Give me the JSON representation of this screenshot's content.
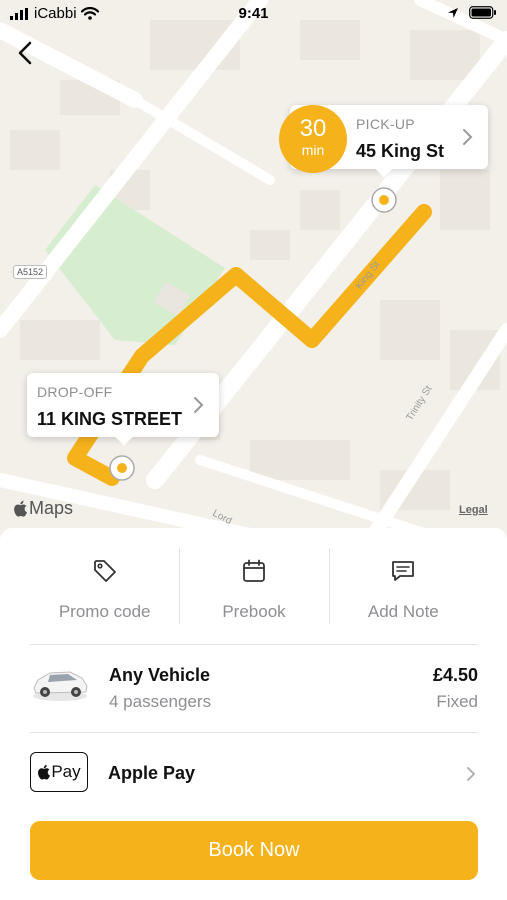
{
  "status_bar": {
    "carrier": "iCabbi",
    "time": "9:41",
    "icons": [
      "signal-icon",
      "wifi-icon",
      "location-arrow-icon",
      "battery-icon"
    ]
  },
  "map": {
    "road_badge": "A5152",
    "street_labels": [
      "King St",
      "Trinity St",
      "Lord"
    ],
    "maps_logo": "Maps",
    "legal": "Legal",
    "route_color": "#F5B21B"
  },
  "pickup": {
    "eta_value": "30",
    "eta_unit": "min",
    "label": "PICK-UP",
    "address": "45 King St"
  },
  "dropoff": {
    "label": "DROP-OFF",
    "address": "11 KING STREET"
  },
  "actions": [
    {
      "label": "Promo code",
      "icon": "tag-icon"
    },
    {
      "label": "Prebook",
      "icon": "calendar-icon"
    },
    {
      "label": "Add Note",
      "icon": "message-icon"
    }
  ],
  "vehicle": {
    "name": "Any Vehicle",
    "passengers": "4 passengers",
    "price": "£4.50",
    "price_type": "Fixed"
  },
  "payment": {
    "badge_text": "Pay",
    "label": "Apple Pay"
  },
  "book_button": "Book Now",
  "colors": {
    "accent": "#F5B21B",
    "park": "#D6EDCF",
    "map_background": "#F3F0EA"
  }
}
